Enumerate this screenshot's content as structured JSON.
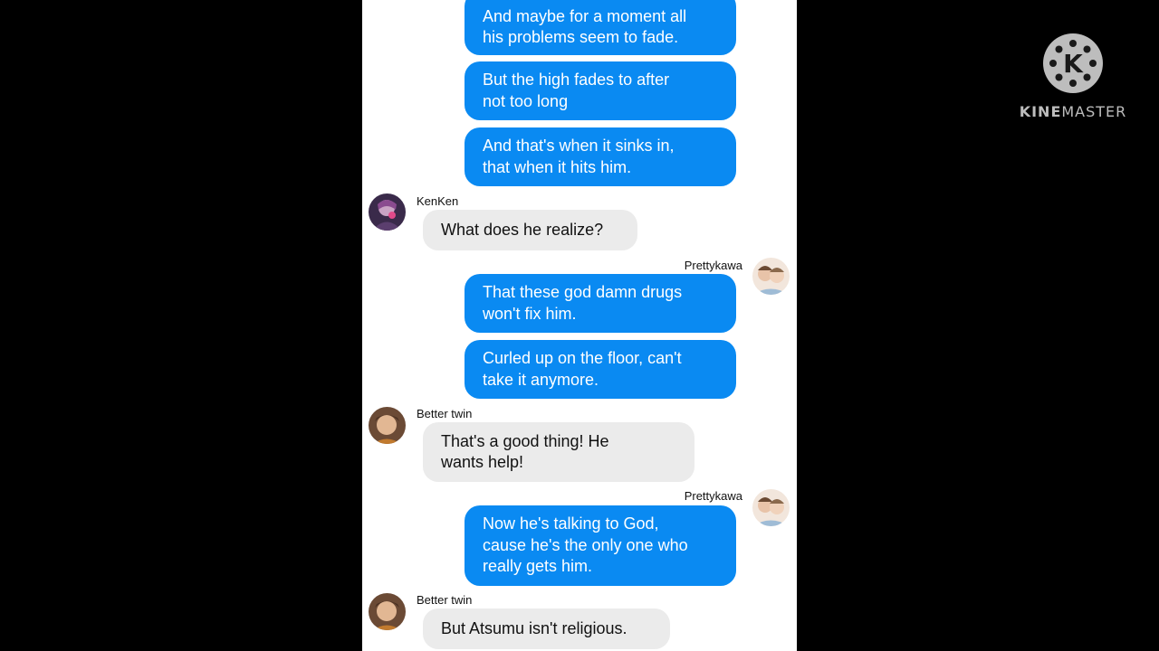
{
  "watermark": {
    "brand_bold": "KINE",
    "brand_light": "MASTER",
    "logo_letter": "K"
  },
  "messages": [
    {
      "sender": "Prettykawa",
      "text": "And maybe for a moment all\nhis problems seem to fade."
    },
    {
      "sender": "Prettykawa",
      "text": "But the high fades to after\nnot too long"
    },
    {
      "sender": "Prettykawa",
      "text": "And that's when it sinks in,\nthat when it hits him."
    },
    {
      "sender": "KenKen",
      "text": "What does he realize?"
    },
    {
      "sender": "Prettykawa",
      "text": "That these god damn drugs\nwon't fix him."
    },
    {
      "sender": "Prettykawa",
      "text": "Curled up on the floor, can't\ntake it anymore."
    },
    {
      "sender": "Better twin",
      "text": "That's a good thing! He\nwants help!"
    },
    {
      "sender": "Prettykawa",
      "text": "Now he's talking to God,\ncause he's the only one who\nreally gets him."
    },
    {
      "sender": "Better twin",
      "text": "But Atsumu isn't religious."
    }
  ],
  "colors": {
    "sent_bubble": "#0a8af2",
    "received_bubble": "#ebebeb",
    "background": "#000000",
    "chat_background": "#ffffff"
  }
}
